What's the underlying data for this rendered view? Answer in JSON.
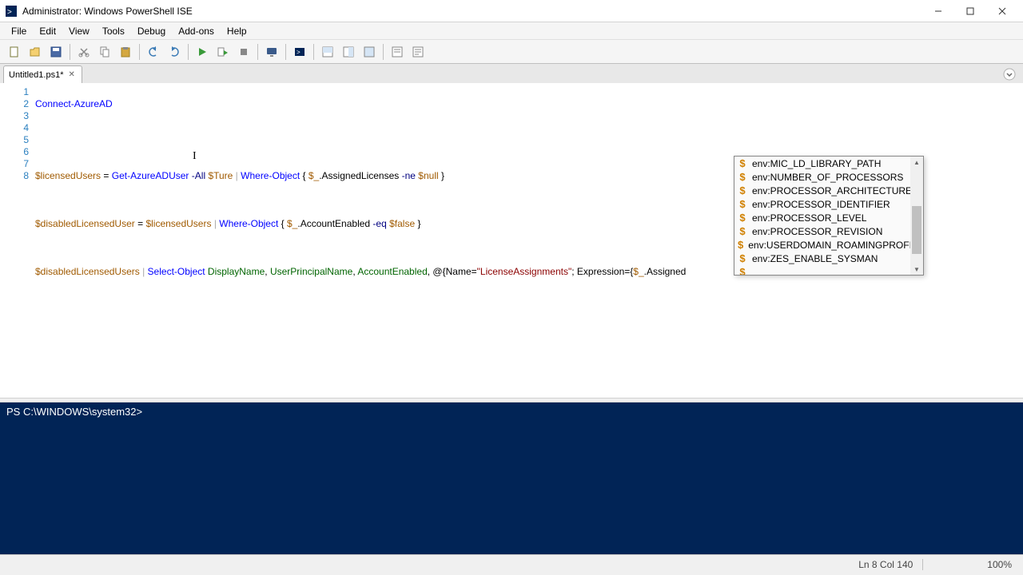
{
  "window": {
    "title": "Administrator: Windows PowerShell ISE"
  },
  "menu": {
    "file": "File",
    "edit": "Edit",
    "view": "View",
    "tools": "Tools",
    "debug": "Debug",
    "addons": "Add-ons",
    "help": "Help"
  },
  "tab": {
    "label": "Untitled1.ps1*"
  },
  "lines": {
    "l1": "1",
    "l2": "2",
    "l3": "3",
    "l4": "4",
    "l5": "5",
    "l6": "6",
    "l7": "7",
    "l8": "8"
  },
  "code": {
    "l1_cmd": "Connect-AzureAD",
    "l4_var": "$licensedUsers",
    "l4_eq": " = ",
    "l4_cmd": "Get-AzureADUser",
    "l4_param1": " -All ",
    "l4_val1": "$Ture",
    "l4_pipe": " | ",
    "l4_cmd2": "Where-Object",
    "l4_brace": " { ",
    "l4_it": "$_",
    "l4_prop": ".AssignedLicenses",
    "l4_op": " -ne ",
    "l4_null": "$null",
    "l4_end": " }",
    "l6_var": "$disabledLicensedUser",
    "l6_eq": " = ",
    "l6_src": "$licensedUsers",
    "l6_pipe": " | ",
    "l6_cmd": "Where-Object",
    "l6_brace": " { ",
    "l6_it": "$_",
    "l6_prop": ".AccountEnabled",
    "l6_op": " -eq ",
    "l6_false": "$false",
    "l6_end": " }",
    "l8_var": "$disabledLicensedUsers",
    "l8_pipe": " | ",
    "l8_cmd": "Select-Object",
    "l8_sp": " ",
    "l8_f1": "DisplayName",
    "l8_c1": ", ",
    "l8_f2": "UserPrincipalName",
    "l8_c2": ", ",
    "l8_f3": "AccountEnabled",
    "l8_c3": ", ",
    "l8_hash": "@{Name=",
    "l8_str": "\"LicenseAssignments\"",
    "l8_semi": "; Expression={",
    "l8_it": "$_",
    "l8_prop": ".Assigned"
  },
  "intellisense": {
    "i0": "env:MIC_LD_LIBRARY_PATH",
    "i1": "env:NUMBER_OF_PROCESSORS",
    "i2": "env:PROCESSOR_ARCHITECTURE",
    "i3": "env:PROCESSOR_IDENTIFIER",
    "i4": "env:PROCESSOR_LEVEL",
    "i5": "env:PROCESSOR_REVISION",
    "i6": "env:USERDOMAIN_ROAMINGPROFILE",
    "i7": "env:ZES_ENABLE_SYSMAN",
    "i8": "_"
  },
  "console": {
    "prompt": "PS C:\\WINDOWS\\system32> "
  },
  "status": {
    "pos": "Ln 8  Col 140",
    "zoom": "100%"
  }
}
